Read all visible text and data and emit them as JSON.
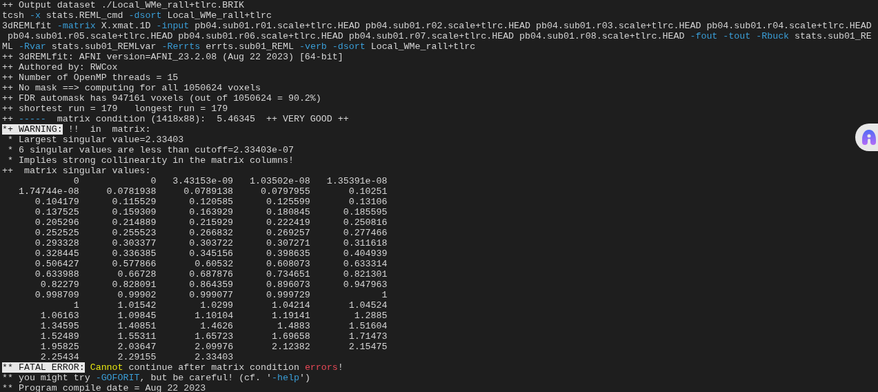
{
  "terminal": {
    "lines_before": [
      {
        "segments": [
          {
            "text": "++ Output dataset ./Local_WMe_rall+tlrc.BRIK",
            "kind": "plain"
          }
        ]
      },
      {
        "segments": [
          {
            "text": "tcsh ",
            "kind": "plain"
          },
          {
            "text": "-x",
            "kind": "flag"
          },
          {
            "text": " stats.REML_cmd ",
            "kind": "plain"
          },
          {
            "text": "-dsort",
            "kind": "flag"
          },
          {
            "text": " Local_WMe_rall+tlrc",
            "kind": "plain"
          }
        ]
      },
      {
        "segments": [
          {
            "text": "3dREMLfit ",
            "kind": "plain"
          },
          {
            "text": "-matrix",
            "kind": "flag"
          },
          {
            "text": " X.xmat.1D ",
            "kind": "plain"
          },
          {
            "text": "-input",
            "kind": "flag"
          },
          {
            "text": " pb04.sub01.r01.scale+tlrc.HEAD pb04.sub01.r02.scale+tlrc.HEAD pb04.sub01.r03.scale+tlrc.HEAD pb04.sub01.r04.scale+tlrc.HEAD",
            "kind": "plain"
          }
        ]
      },
      {
        "segments": [
          {
            "text": " pb04.sub01.r05.scale+tlrc.HEAD pb04.sub01.r06.scale+tlrc.HEAD pb04.sub01.r07.scale+tlrc.HEAD pb04.sub01.r08.scale+tlrc.HEAD ",
            "kind": "plain"
          },
          {
            "text": "-fout",
            "kind": "flag"
          },
          {
            "text": " -tout",
            "kind": "flag"
          },
          {
            "text": " -Rbuck",
            "kind": "flag"
          },
          {
            "text": " stats.sub01_RE",
            "kind": "plain"
          }
        ]
      },
      {
        "segments": [
          {
            "text": "ML ",
            "kind": "plain"
          },
          {
            "text": "-Rvar",
            "kind": "flag"
          },
          {
            "text": " stats.sub01_REMLvar ",
            "kind": "plain"
          },
          {
            "text": "-Rerrts",
            "kind": "flag"
          },
          {
            "text": " errts.sub01_REML ",
            "kind": "plain"
          },
          {
            "text": "-verb",
            "kind": "flag"
          },
          {
            "text": " -dsort",
            "kind": "flag"
          },
          {
            "text": " Local_WMe_rall+tlrc",
            "kind": "plain"
          }
        ]
      },
      {
        "segments": [
          {
            "text": "++ 3dREMLfit: AFNI version=AFNI_23.2.08 (Aug 22 2023) [64-bit]",
            "kind": "plain"
          }
        ]
      },
      {
        "segments": [
          {
            "text": "++ Authored by: RWCox",
            "kind": "plain"
          }
        ]
      },
      {
        "segments": [
          {
            "text": "++ Number of OpenMP threads = 15",
            "kind": "plain"
          }
        ]
      },
      {
        "segments": [
          {
            "text": "++ No mask ==> computing for all 1050624 voxels",
            "kind": "plain"
          }
        ]
      },
      {
        "segments": [
          {
            "text": "++ FDR automask has 947161 voxels (out of 1050624 = 90.2%)",
            "kind": "plain"
          }
        ]
      },
      {
        "segments": [
          {
            "text": "++ shortest run = 179   longest run = 179",
            "kind": "plain"
          }
        ]
      },
      {
        "segments": [
          {
            "text": "++ ",
            "kind": "plain"
          },
          {
            "text": "-----",
            "kind": "flag"
          },
          {
            "text": "  matrix condition (1418x88):  5.46345  ++ VERY GOOD ++",
            "kind": "plain"
          }
        ]
      },
      {
        "segments": [
          {
            "text": "*+ WARNING:",
            "kind": "highlight"
          },
          {
            "text": " !!  in  matrix:",
            "kind": "plain"
          }
        ]
      },
      {
        "segments": [
          {
            "text": " * Largest singular value=2.33403",
            "kind": "plain"
          }
        ]
      },
      {
        "segments": [
          {
            "text": " * 6 singular values are less than cutoff=2.33403e-07",
            "kind": "plain"
          }
        ]
      },
      {
        "segments": [
          {
            "text": " * Implies strong collinearity in the matrix columns!",
            "kind": "plain"
          }
        ]
      },
      {
        "segments": [
          {
            "text": "++  matrix singular values:",
            "kind": "plain"
          }
        ]
      }
    ],
    "singular_values": [
      [
        "0",
        "0",
        "3.43153e-09",
        "1.03502e-08",
        "1.35391e-08"
      ],
      [
        "1.74744e-08",
        "0.0781938",
        "0.0789138",
        "0.0797955",
        "0.10251"
      ],
      [
        "0.104179",
        "0.115529",
        "0.120585",
        "0.125599",
        "0.13106"
      ],
      [
        "0.137525",
        "0.159309",
        "0.163929",
        "0.180845",
        "0.185595"
      ],
      [
        "0.205296",
        "0.214889",
        "0.215929",
        "0.222419",
        "0.250816"
      ],
      [
        "0.252525",
        "0.255523",
        "0.266832",
        "0.269257",
        "0.277466"
      ],
      [
        "0.293328",
        "0.303377",
        "0.303722",
        "0.307271",
        "0.311618"
      ],
      [
        "0.328445",
        "0.336385",
        "0.345156",
        "0.398635",
        "0.404939"
      ],
      [
        "0.506427",
        "0.577866",
        "0.60532",
        "0.608073",
        "0.633314"
      ],
      [
        "0.633988",
        "0.66728",
        "0.687876",
        "0.734651",
        "0.821301"
      ],
      [
        "0.82279",
        "0.828091",
        "0.864359",
        "0.896073",
        "0.947963"
      ],
      [
        "0.998709",
        "0.99902",
        "0.999077",
        "0.999729",
        "1"
      ],
      [
        "1",
        "1.01542",
        "1.0299",
        "1.04214",
        "1.04524"
      ],
      [
        "1.06163",
        "1.09845",
        "1.10104",
        "1.19141",
        "1.2885"
      ],
      [
        "1.34595",
        "1.40851",
        "1.4626",
        "1.4883",
        "1.51604"
      ],
      [
        "1.52489",
        "1.55311",
        "1.65723",
        "1.69658",
        "1.71473"
      ],
      [
        "1.95825",
        "2.03647",
        "2.09976",
        "2.12382",
        "2.15475"
      ],
      [
        "2.25434",
        "2.29155",
        "2.33403"
      ]
    ],
    "lines_after": [
      {
        "segments": [
          {
            "text": "** FATAL ERROR:",
            "kind": "highlight"
          },
          {
            "text": " Cannot",
            "kind": "warn"
          },
          {
            "text": " continue after matrix condition ",
            "kind": "plain"
          },
          {
            "text": "errors",
            "kind": "error"
          },
          {
            "text": "!",
            "kind": "plain"
          }
        ]
      },
      {
        "segments": [
          {
            "text": "** you might try ",
            "kind": "plain"
          },
          {
            "text": "-GOFORIT",
            "kind": "flag"
          },
          {
            "text": ", but be careful! (cf. '",
            "kind": "plain"
          },
          {
            "text": "-help",
            "kind": "flag"
          },
          {
            "text": "')",
            "kind": "plain"
          }
        ]
      },
      {
        "segments": [
          {
            "text": "** Program compile date = Aug 22 2023",
            "kind": "plain"
          }
        ]
      }
    ]
  }
}
